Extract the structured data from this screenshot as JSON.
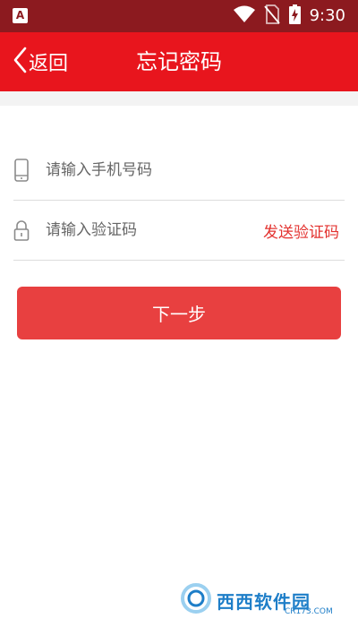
{
  "status_bar": {
    "time": "9:30",
    "app_badge": "A",
    "icons": [
      "wifi-icon",
      "no-sim-icon",
      "battery-charging-icon"
    ]
  },
  "header": {
    "back_label": "返回",
    "title": "忘记密码"
  },
  "form": {
    "phone_placeholder": "请输入手机号码",
    "code_placeholder": "请输入验证码",
    "send_code_label": "发送验证码",
    "next_label": "下一步"
  },
  "watermark": {
    "text": "西西软件园",
    "sub": "CR173.COM"
  },
  "colors": {
    "status_bar": "#8c1a1f",
    "header": "#e8151d",
    "button": "#e84040",
    "accent_text": "#e3322f"
  }
}
